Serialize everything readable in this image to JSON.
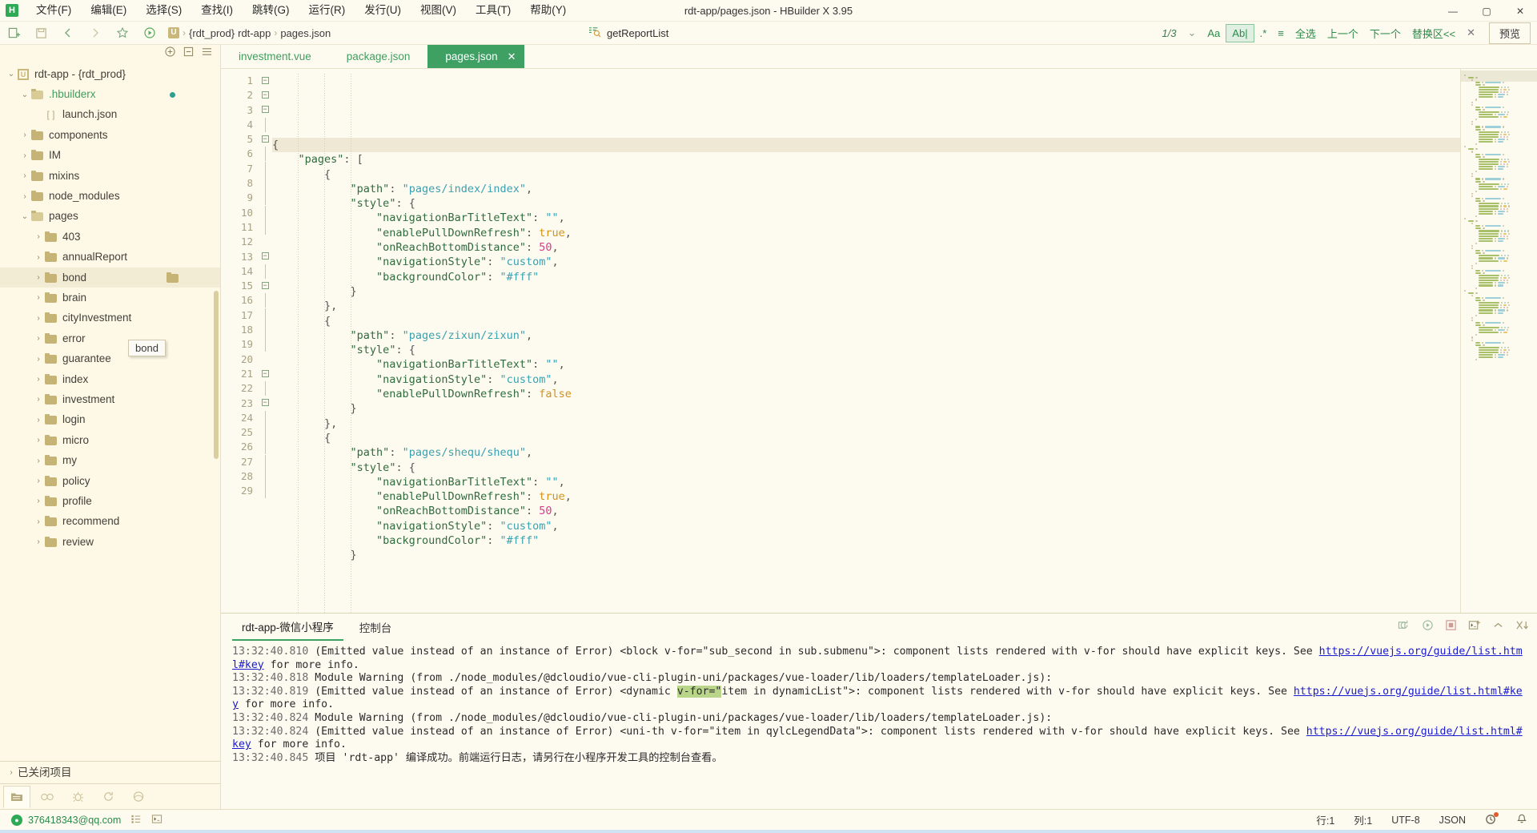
{
  "window": {
    "title": "rdt-app/pages.json - HBuilder X 3.95",
    "logo_text": "H",
    "controls": {
      "minimize": "—",
      "maximize": "▢",
      "close": "✕"
    }
  },
  "menubar": {
    "items": [
      {
        "label": "文件(F)",
        "name": "menu-file"
      },
      {
        "label": "编辑(E)",
        "name": "menu-edit"
      },
      {
        "label": "选择(S)",
        "name": "menu-select"
      },
      {
        "label": "查找(I)",
        "name": "menu-find"
      },
      {
        "label": "跳转(G)",
        "name": "menu-goto"
      },
      {
        "label": "运行(R)",
        "name": "menu-run"
      },
      {
        "label": "发行(U)",
        "name": "menu-publish"
      },
      {
        "label": "视图(V)",
        "name": "menu-view"
      },
      {
        "label": "工具(T)",
        "name": "menu-tools"
      },
      {
        "label": "帮助(Y)",
        "name": "menu-help"
      }
    ]
  },
  "toolbar": {
    "icons": [
      "new-file-icon",
      "save-icon",
      "back-icon",
      "forward-icon",
      "star-icon",
      "run-icon"
    ],
    "breadcrumb": {
      "project_badge": "U",
      "items": [
        "{rdt_prod}",
        "rdt-app",
        "pages.json"
      ],
      "separator": "›"
    },
    "search": {
      "icon": "find-symbol-icon",
      "value": "getReportList",
      "placeholder": "查找"
    },
    "find_controls": {
      "match_count": "1/3",
      "chevron": "⌄",
      "case_sensitive": "Aa",
      "whole_word": "Ab|",
      "regex": ".*",
      "in_selection": "≡",
      "select_all": "全选",
      "previous": "上一个",
      "next": "下一个",
      "replace_toggle": "替换区<<",
      "close": "✕",
      "preview": "预览"
    }
  },
  "sidebar": {
    "header_icons": [
      "add-project-icon",
      "collapse-all-icon",
      "menu-icon"
    ],
    "tree": [
      {
        "label": "rdt-app - {rdt_prod}",
        "depth": 0,
        "icon": "project-icon",
        "twist": "⌄",
        "name": "tree-item-rdt-app"
      },
      {
        "label": ".hbuilderx",
        "depth": 1,
        "icon": "folder-open-icon",
        "twist": "⌄",
        "green": true,
        "modified": true,
        "name": "tree-item-hbuilderx"
      },
      {
        "label": "launch.json",
        "depth": 2,
        "icon": "json-file-icon",
        "twist": "",
        "name": "tree-item-launch-json"
      },
      {
        "label": "components",
        "depth": 1,
        "icon": "folder-icon",
        "twist": "›",
        "name": "tree-item-components"
      },
      {
        "label": "IM",
        "depth": 1,
        "icon": "folder-icon",
        "twist": "›",
        "name": "tree-item-im"
      },
      {
        "label": "mixins",
        "depth": 1,
        "icon": "folder-icon",
        "twist": "›",
        "name": "tree-item-mixins"
      },
      {
        "label": "node_modules",
        "depth": 1,
        "icon": "folder-icon",
        "twist": "›",
        "name": "tree-item-node-modules"
      },
      {
        "label": "pages",
        "depth": 1,
        "icon": "folder-open-icon",
        "twist": "⌄",
        "name": "tree-item-pages"
      },
      {
        "label": "403",
        "depth": 2,
        "icon": "folder-icon",
        "twist": "›",
        "name": "tree-item-403"
      },
      {
        "label": "annualReport",
        "depth": 2,
        "icon": "folder-icon",
        "twist": "›",
        "name": "tree-item-annualreport"
      },
      {
        "label": "bond",
        "depth": 2,
        "icon": "folder-icon",
        "twist": "›",
        "selected": true,
        "drag_badge": true,
        "name": "tree-item-bond"
      },
      {
        "label": "brain",
        "depth": 2,
        "icon": "folder-icon",
        "twist": "›",
        "name": "tree-item-brain"
      },
      {
        "label": "cityInvestment",
        "depth": 2,
        "icon": "folder-icon",
        "twist": "›",
        "name": "tree-item-cityinvestment"
      },
      {
        "label": "error",
        "depth": 2,
        "icon": "folder-icon",
        "twist": "›",
        "name": "tree-item-error"
      },
      {
        "label": "guarantee",
        "depth": 2,
        "icon": "folder-icon",
        "twist": "›",
        "name": "tree-item-guarantee"
      },
      {
        "label": "index",
        "depth": 2,
        "icon": "folder-icon",
        "twist": "›",
        "name": "tree-item-index"
      },
      {
        "label": "investment",
        "depth": 2,
        "icon": "folder-icon",
        "twist": "›",
        "name": "tree-item-investment"
      },
      {
        "label": "login",
        "depth": 2,
        "icon": "folder-icon",
        "twist": "›",
        "name": "tree-item-login"
      },
      {
        "label": "micro",
        "depth": 2,
        "icon": "folder-icon",
        "twist": "›",
        "name": "tree-item-micro"
      },
      {
        "label": "my",
        "depth": 2,
        "icon": "folder-icon",
        "twist": "›",
        "name": "tree-item-my"
      },
      {
        "label": "policy",
        "depth": 2,
        "icon": "folder-icon",
        "twist": "›",
        "name": "tree-item-policy"
      },
      {
        "label": "profile",
        "depth": 2,
        "icon": "folder-icon",
        "twist": "›",
        "name": "tree-item-profile"
      },
      {
        "label": "recommend",
        "depth": 2,
        "icon": "folder-icon",
        "twist": "›",
        "name": "tree-item-recommend"
      },
      {
        "label": "review",
        "depth": 2,
        "icon": "folder-icon",
        "twist": "›",
        "name": "tree-item-review"
      }
    ],
    "tooltip": "bond",
    "closed_projects": "已关闭项目",
    "footer_icons": [
      "project-manager-icon",
      "search-icon",
      "debug-icon",
      "git-icon",
      "extensions-icon"
    ]
  },
  "editor": {
    "tabs": [
      {
        "label": "investment.vue",
        "active": false,
        "name": "editor-tab-investment-vue"
      },
      {
        "label": "package.json",
        "active": false,
        "name": "editor-tab-package-json"
      },
      {
        "label": "pages.json",
        "active": true,
        "closable": true,
        "name": "editor-tab-pages-json"
      }
    ],
    "lines": [
      {
        "n": 1,
        "fold": "box",
        "current": true,
        "tokens": [
          {
            "t": "{",
            "c": "punc"
          }
        ]
      },
      {
        "n": 2,
        "fold": "box",
        "tokens": [
          {
            "t": "    ",
            "c": "punc"
          },
          {
            "t": "\"pages\"",
            "c": "key"
          },
          {
            "t": ": [",
            "c": "punc"
          }
        ]
      },
      {
        "n": 3,
        "fold": "box",
        "tokens": [
          {
            "t": "        {",
            "c": "punc"
          }
        ]
      },
      {
        "n": 4,
        "fold": "bar",
        "tokens": [
          {
            "t": "            ",
            "c": "punc"
          },
          {
            "t": "\"path\"",
            "c": "key"
          },
          {
            "t": ": ",
            "c": "punc"
          },
          {
            "t": "\"pages/index/index\"",
            "c": "str"
          },
          {
            "t": ",",
            "c": "punc"
          }
        ]
      },
      {
        "n": 5,
        "fold": "box",
        "tokens": [
          {
            "t": "            ",
            "c": "punc"
          },
          {
            "t": "\"style\"",
            "c": "key"
          },
          {
            "t": ": {",
            "c": "punc"
          }
        ]
      },
      {
        "n": 6,
        "fold": "bar",
        "tokens": [
          {
            "t": "                ",
            "c": "punc"
          },
          {
            "t": "\"navigationBarTitleText\"",
            "c": "key"
          },
          {
            "t": ": ",
            "c": "punc"
          },
          {
            "t": "\"\"",
            "c": "str"
          },
          {
            "t": ",",
            "c": "punc"
          }
        ]
      },
      {
        "n": 7,
        "fold": "bar",
        "tokens": [
          {
            "t": "                ",
            "c": "punc"
          },
          {
            "t": "\"enablePullDownRefresh\"",
            "c": "key"
          },
          {
            "t": ": ",
            "c": "punc"
          },
          {
            "t": "true",
            "c": "bool"
          },
          {
            "t": ",",
            "c": "punc"
          }
        ]
      },
      {
        "n": 8,
        "fold": "bar",
        "tokens": [
          {
            "t": "                ",
            "c": "punc"
          },
          {
            "t": "\"onReachBottomDistance\"",
            "c": "key"
          },
          {
            "t": ": ",
            "c": "punc"
          },
          {
            "t": "50",
            "c": "num"
          },
          {
            "t": ",",
            "c": "punc"
          }
        ]
      },
      {
        "n": 9,
        "fold": "bar",
        "tokens": [
          {
            "t": "                ",
            "c": "punc"
          },
          {
            "t": "\"navigationStyle\"",
            "c": "key"
          },
          {
            "t": ": ",
            "c": "punc"
          },
          {
            "t": "\"custom\"",
            "c": "str"
          },
          {
            "t": ",",
            "c": "punc"
          }
        ]
      },
      {
        "n": 10,
        "fold": "bar",
        "tokens": [
          {
            "t": "                ",
            "c": "punc"
          },
          {
            "t": "\"backgroundColor\"",
            "c": "key"
          },
          {
            "t": ": ",
            "c": "punc"
          },
          {
            "t": "\"#fff\"",
            "c": "str"
          }
        ]
      },
      {
        "n": 11,
        "fold": "bar",
        "tokens": [
          {
            "t": "            }",
            "c": "punc"
          }
        ]
      },
      {
        "n": 12,
        "fold": "",
        "tokens": [
          {
            "t": "        },",
            "c": "punc"
          }
        ]
      },
      {
        "n": 13,
        "fold": "box",
        "tokens": [
          {
            "t": "        {",
            "c": "punc"
          }
        ]
      },
      {
        "n": 14,
        "fold": "bar",
        "tokens": [
          {
            "t": "            ",
            "c": "punc"
          },
          {
            "t": "\"path\"",
            "c": "key"
          },
          {
            "t": ": ",
            "c": "punc"
          },
          {
            "t": "\"pages/zixun/zixun\"",
            "c": "str"
          },
          {
            "t": ",",
            "c": "punc"
          }
        ]
      },
      {
        "n": 15,
        "fold": "box",
        "tokens": [
          {
            "t": "            ",
            "c": "punc"
          },
          {
            "t": "\"style\"",
            "c": "key"
          },
          {
            "t": ": {",
            "c": "punc"
          }
        ]
      },
      {
        "n": 16,
        "fold": "bar",
        "tokens": [
          {
            "t": "                ",
            "c": "punc"
          },
          {
            "t": "\"navigationBarTitleText\"",
            "c": "key"
          },
          {
            "t": ": ",
            "c": "punc"
          },
          {
            "t": "\"\"",
            "c": "str"
          },
          {
            "t": ",",
            "c": "punc"
          }
        ]
      },
      {
        "n": 17,
        "fold": "bar",
        "tokens": [
          {
            "t": "                ",
            "c": "punc"
          },
          {
            "t": "\"navigationStyle\"",
            "c": "key"
          },
          {
            "t": ": ",
            "c": "punc"
          },
          {
            "t": "\"custom\"",
            "c": "str"
          },
          {
            "t": ",",
            "c": "punc"
          }
        ]
      },
      {
        "n": 18,
        "fold": "bar",
        "tokens": [
          {
            "t": "                ",
            "c": "punc"
          },
          {
            "t": "\"enablePullDownRefresh\"",
            "c": "key"
          },
          {
            "t": ": ",
            "c": "punc"
          },
          {
            "t": "false",
            "c": "bool"
          }
        ]
      },
      {
        "n": 19,
        "fold": "bar",
        "tokens": [
          {
            "t": "            }",
            "c": "punc"
          }
        ]
      },
      {
        "n": 20,
        "fold": "",
        "tokens": [
          {
            "t": "        },",
            "c": "punc"
          }
        ]
      },
      {
        "n": 21,
        "fold": "box",
        "tokens": [
          {
            "t": "        {",
            "c": "punc"
          }
        ]
      },
      {
        "n": 22,
        "fold": "bar",
        "tokens": [
          {
            "t": "            ",
            "c": "punc"
          },
          {
            "t": "\"path\"",
            "c": "key"
          },
          {
            "t": ": ",
            "c": "punc"
          },
          {
            "t": "\"pages/shequ/shequ\"",
            "c": "str"
          },
          {
            "t": ",",
            "c": "punc"
          }
        ]
      },
      {
        "n": 23,
        "fold": "box",
        "tokens": [
          {
            "t": "            ",
            "c": "punc"
          },
          {
            "t": "\"style\"",
            "c": "key"
          },
          {
            "t": ": {",
            "c": "punc"
          }
        ]
      },
      {
        "n": 24,
        "fold": "bar",
        "tokens": [
          {
            "t": "                ",
            "c": "punc"
          },
          {
            "t": "\"navigationBarTitleText\"",
            "c": "key"
          },
          {
            "t": ": ",
            "c": "punc"
          },
          {
            "t": "\"\"",
            "c": "str"
          },
          {
            "t": ",",
            "c": "punc"
          }
        ]
      },
      {
        "n": 25,
        "fold": "bar",
        "tokens": [
          {
            "t": "                ",
            "c": "punc"
          },
          {
            "t": "\"enablePullDownRefresh\"",
            "c": "key"
          },
          {
            "t": ": ",
            "c": "punc"
          },
          {
            "t": "true",
            "c": "bool"
          },
          {
            "t": ",",
            "c": "punc"
          }
        ]
      },
      {
        "n": 26,
        "fold": "bar",
        "tokens": [
          {
            "t": "                ",
            "c": "punc"
          },
          {
            "t": "\"onReachBottomDistance\"",
            "c": "key"
          },
          {
            "t": ": ",
            "c": "punc"
          },
          {
            "t": "50",
            "c": "num"
          },
          {
            "t": ",",
            "c": "punc"
          }
        ]
      },
      {
        "n": 27,
        "fold": "bar",
        "tokens": [
          {
            "t": "                ",
            "c": "punc"
          },
          {
            "t": "\"navigationStyle\"",
            "c": "key"
          },
          {
            "t": ": ",
            "c": "punc"
          },
          {
            "t": "\"custom\"",
            "c": "str"
          },
          {
            "t": ",",
            "c": "punc"
          }
        ]
      },
      {
        "n": 28,
        "fold": "bar",
        "tokens": [
          {
            "t": "                ",
            "c": "punc"
          },
          {
            "t": "\"backgroundColor\"",
            "c": "key"
          },
          {
            "t": ": ",
            "c": "punc"
          },
          {
            "t": "\"#fff\"",
            "c": "str"
          }
        ]
      },
      {
        "n": 29,
        "fold": "bar",
        "tokens": [
          {
            "t": "            }",
            "c": "punc"
          }
        ]
      }
    ]
  },
  "console": {
    "tabs": [
      {
        "label": "rdt-app-微信小程序",
        "active": true,
        "name": "console-tab-rdt-app"
      },
      {
        "label": "控制台",
        "active": false,
        "name": "console-tab-console"
      }
    ],
    "tools": [
      "restart-icon",
      "run-icon",
      "stop-icon",
      "new-terminal-icon",
      "collapse-icon",
      "clear-icon"
    ],
    "log": [
      {
        "time": "13:32:40.810",
        "before": " (Emitted value instead of an instance of Error) <block v-for=\"sub_second in sub.submenu\">: component lists rendered with v-for should have explicit keys. See ",
        "link": "https://vuejs.org/guide/list.html#key",
        "after": " for more info."
      },
      {
        "time": "13:32:40.818",
        "before": " Module Warning (from ./node_modules/@dcloudio/vue-cli-plugin-uni/packages/vue-loader/lib/loaders/templateLoader.js):",
        "link": "",
        "after": ""
      },
      {
        "time": "13:32:40.819",
        "before": " (Emitted value instead of an instance of Error) <dynamic v-for=\"item in dynamicList\">: component lists rendered with v-for should have explicit keys. See ",
        "link": "https://vuejs.org/guide/list.html#key",
        "after": " for more info."
      },
      {
        "time": "13:32:40.824",
        "before": " Module Warning (from ./node_modules/@dcloudio/vue-cli-plugin-uni/packages/vue-loader/lib/loaders/templateLoader.js):",
        "link": "",
        "after": ""
      },
      {
        "time": "13:32:40.824",
        "before": " (Emitted value instead of an instance of Error) <uni-th v-for=\"item in qylcLegendData\">: component lists rendered with v-for should have explicit keys. See ",
        "link": "https://vuejs.org/guide/list.html#key",
        "after": " for more info."
      },
      {
        "time": "13:32:40.845",
        "before": " 项目 'rdt-app' 编译成功。前端运行日志，请另行在小程序开发工具的控制台查看。",
        "link": "",
        "after": ""
      }
    ]
  },
  "statusbar": {
    "account": "376418343@qq.com",
    "left_icons": [
      "outline-icon",
      "terminal-icon"
    ],
    "line": "行:1",
    "column": "列:1",
    "encoding": "UTF-8",
    "language": "JSON",
    "icons": [
      "history-icon",
      "bell-icon"
    ]
  },
  "colors": {
    "accent": "#3fa063",
    "background": "#fdfbf0",
    "sidebar_bg": "#fdf9e6",
    "key": "#2f6b3d",
    "string": "#3aa1b0",
    "number": "#e0368a",
    "boolean": "#d49218",
    "link": "#1a1ad0",
    "folder": "#c5b476"
  }
}
